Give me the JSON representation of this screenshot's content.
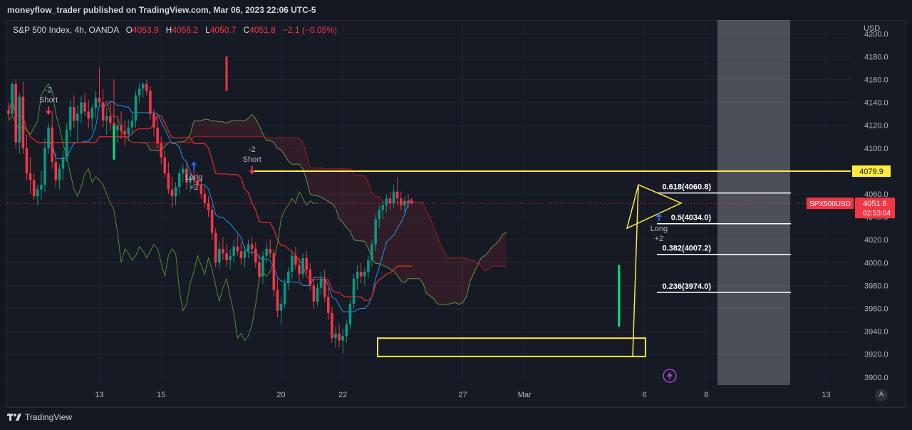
{
  "publisher": "moneyflow_trader published on TradingView.com, Mar 06, 2023 22:06 UTC-5",
  "legend": {
    "symbol": "S&P 500 Index, 4h, OANDA",
    "o_label": "O",
    "o_value": "4053.9",
    "h_label": "H",
    "h_value": "4056.2",
    "l_label": "L",
    "l_value": "4050.7",
    "c_label": "C",
    "c_value": "4051.8",
    "change": "−2.1 (−0.05%)"
  },
  "currency": "USD",
  "brand": "TradingView",
  "colors": {
    "up": "#089981",
    "down": "#f23645",
    "highlight": "#ffeb3b",
    "baseline": "#2962ff",
    "leading": "#7cb342",
    "lagging": "#b71c1c",
    "conversion": "#2196f3"
  },
  "chart_data": {
    "type": "candlestick",
    "interval": "4h",
    "ylim": [
      3893,
      4212
    ],
    "y_ticks": [
      "3900.0",
      "3920.0",
      "3940.0",
      "3960.0",
      "3980.0",
      "4000.0",
      "4020.0",
      "4040.0",
      "4060.0",
      "4080.0",
      "4100.0",
      "4120.0",
      "4140.0",
      "4160.0",
      "4180.0",
      "4200.0"
    ],
    "x_ticks": [
      {
        "label": "13",
        "bar": 25
      },
      {
        "label": "15",
        "bar": 42
      },
      {
        "label": "20",
        "bar": 75
      },
      {
        "label": "22",
        "bar": 92
      },
      {
        "label": "27",
        "bar": 125
      },
      {
        "label": "Mar",
        "bar": 142
      },
      {
        "label": "6",
        "bar": 175
      },
      {
        "label": "8",
        "bar": 192
      },
      {
        "label": "13",
        "bar": 225
      }
    ],
    "last_price": {
      "value": 4051.8,
      "symbol": "SPX500USD",
      "countdown": "02:53:04"
    },
    "horizontal_level": {
      "value": 4079.9,
      "label": "4079.9"
    },
    "fib_levels": [
      {
        "label": "0.618(4060.8)",
        "value": 4060.8
      },
      {
        "label": "0.5(4034.0)",
        "value": 4034.0
      },
      {
        "label": "0.382(4007.2)",
        "value": 4007.2
      },
      {
        "label": "0.236(3974.0)",
        "value": 3974.0
      }
    ],
    "signals": [
      {
        "type": "Short",
        "strength": "-2",
        "bar": 11,
        "price": 4140
      },
      {
        "type": "Long",
        "strength": "+2",
        "bar": 51,
        "price": 4085
      },
      {
        "type": "Short",
        "strength": "-2",
        "bar": 67,
        "price": 4088
      },
      {
        "type": "Long",
        "strength": "+2",
        "bar": 179,
        "price": 4040
      }
    ],
    "candles": [
      [
        4133,
        4140,
        4125,
        4130
      ],
      [
        4130,
        4158,
        4128,
        4156
      ],
      [
        4156,
        4160,
        4100,
        4105
      ],
      [
        4105,
        4148,
        4095,
        4145
      ],
      [
        4145,
        4158,
        4095,
        4100
      ],
      [
        4100,
        4112,
        4072,
        4078
      ],
      [
        4078,
        4092,
        4060,
        4072
      ],
      [
        4072,
        4078,
        4055,
        4058
      ],
      [
        4058,
        4068,
        4050,
        4064
      ],
      [
        4064,
        4080,
        4055,
        4068
      ],
      [
        4068,
        4108,
        4062,
        4100
      ],
      [
        4100,
        4122,
        4095,
        4118
      ],
      [
        4118,
        4132,
        4082,
        4088
      ],
      [
        4088,
        4096,
        4066,
        4072
      ],
      [
        4072,
        4086,
        4064,
        4082
      ],
      [
        4082,
        4098,
        4072,
        4092
      ],
      [
        4092,
        4122,
        4088,
        4116
      ],
      [
        4116,
        4142,
        4110,
        4136
      ],
      [
        4136,
        4146,
        4118,
        4124
      ],
      [
        4124,
        4138,
        4105,
        4130
      ],
      [
        4130,
        4146,
        4122,
        4140
      ],
      [
        4140,
        4148,
        4128,
        4132
      ],
      [
        4132,
        4142,
        4118,
        4126
      ],
      [
        4126,
        4138,
        4116,
        4135
      ],
      [
        4135,
        4150,
        4126,
        4144
      ],
      [
        4144,
        4170,
        4138,
        4140
      ],
      [
        4140,
        4152,
        4118,
        4124
      ],
      [
        4124,
        4135,
        4112,
        4128
      ],
      [
        4128,
        4140,
        4115,
        4122
      ],
      [
        4122,
        4160,
        4110,
        4116
      ],
      [
        4116,
        4126,
        4105,
        4120
      ],
      [
        4120,
        4132,
        4108,
        4115
      ],
      [
        4115,
        4124,
        4102,
        4112
      ],
      [
        4112,
        4125,
        4106,
        4118
      ],
      [
        4118,
        4130,
        4112,
        4124
      ],
      [
        4124,
        4150,
        4118,
        4146
      ],
      [
        4146,
        4157,
        4140,
        4152
      ],
      [
        4152,
        4158,
        4144,
        4156
      ],
      [
        4156,
        4160,
        4146,
        4150
      ],
      [
        4150,
        4154,
        4125,
        4130
      ],
      [
        4130,
        4134,
        4110,
        4118
      ],
      [
        4118,
        4128,
        4100,
        4104
      ],
      [
        4104,
        4110,
        4086,
        4092
      ],
      [
        4092,
        4098,
        4074,
        4078
      ],
      [
        4078,
        4088,
        4060,
        4064
      ],
      [
        4064,
        4075,
        4048,
        4058
      ],
      [
        4058,
        4070,
        4050,
        4066
      ],
      [
        4066,
        4082,
        4060,
        4078
      ],
      [
        4078,
        4086,
        4070,
        4082
      ],
      [
        4082,
        4088,
        4064,
        4070
      ],
      [
        4070,
        4080,
        4062,
        4075
      ],
      [
        4075,
        4084,
        4066,
        4072
      ],
      [
        4072,
        4078,
        4064,
        4068
      ],
      [
        4068,
        4074,
        4056,
        4060
      ],
      [
        4060,
        4066,
        4048,
        4052
      ],
      [
        4052,
        4058,
        4040,
        4046
      ],
      [
        4046,
        4050,
        4020,
        4026
      ],
      [
        4026,
        4030,
        3996,
        4000
      ],
      [
        4000,
        4018,
        3995,
        4012
      ],
      [
        4012,
        4022,
        4002,
        4008
      ],
      [
        4008,
        4016,
        3996,
        4002
      ],
      [
        4002,
        4012,
        3994,
        4006
      ],
      [
        4006,
        4020,
        4000,
        4014
      ],
      [
        4014,
        4024,
        4006,
        4010
      ],
      [
        4010,
        4018,
        3998,
        4004
      ],
      [
        4004,
        4014,
        3996,
        4010
      ],
      [
        4010,
        4020,
        4004,
        4016
      ],
      [
        4016,
        4022,
        4006,
        4012
      ],
      [
        4012,
        4018,
        3996,
        4000
      ],
      [
        4000,
        4008,
        3984,
        3988
      ],
      [
        3988,
        4010,
        3982,
        4006
      ],
      [
        4006,
        4018,
        4000,
        4012
      ],
      [
        4012,
        4020,
        4004,
        4008
      ],
      [
        4008,
        4012,
        3970,
        3976
      ],
      [
        3976,
        3986,
        3952,
        3958
      ],
      [
        3958,
        3970,
        3946,
        3964
      ],
      [
        3964,
        3986,
        3960,
        3982
      ],
      [
        3982,
        3996,
        3976,
        3992
      ],
      [
        3992,
        4010,
        3986,
        4006
      ],
      [
        4006,
        4014,
        3994,
        3998
      ],
      [
        3998,
        4004,
        3984,
        3990
      ],
      [
        3990,
        4008,
        3986,
        4004
      ],
      [
        4004,
        4010,
        3990,
        3994
      ],
      [
        3994,
        4000,
        3976,
        3980
      ],
      [
        3980,
        3986,
        3960,
        3966
      ],
      [
        3966,
        3982,
        3962,
        3978
      ],
      [
        3978,
        3992,
        3972,
        3986
      ],
      [
        3986,
        3994,
        3966,
        3970
      ],
      [
        3970,
        3978,
        3950,
        3956
      ],
      [
        3956,
        3962,
        3930,
        3934
      ],
      [
        3934,
        3944,
        3926,
        3938
      ],
      [
        3938,
        3946,
        3926,
        3932
      ],
      [
        3932,
        3942,
        3920,
        3936
      ],
      [
        3936,
        3950,
        3930,
        3946
      ],
      [
        3946,
        3968,
        3942,
        3964
      ],
      [
        3964,
        3990,
        3960,
        3986
      ],
      [
        3986,
        3998,
        3976,
        3992
      ],
      [
        3992,
        4000,
        3982,
        3988
      ],
      [
        3988,
        3996,
        3980,
        3992
      ],
      [
        3992,
        4006,
        3986,
        4002
      ],
      [
        4002,
        4020,
        3996,
        4016
      ],
      [
        4016,
        4042,
        4010,
        4038
      ],
      [
        4038,
        4050,
        4030,
        4046
      ],
      [
        4046,
        4054,
        4038,
        4050
      ],
      [
        4050,
        4060,
        4044,
        4056
      ],
      [
        4056,
        4062,
        4046,
        4052
      ],
      [
        4052,
        4068,
        4048,
        4062
      ],
      [
        4062,
        4074,
        4050,
        4056
      ],
      [
        4056,
        4062,
        4046,
        4050
      ],
      [
        4050,
        4058,
        4044,
        4054
      ],
      [
        4054,
        4060,
        4048,
        4052
      ],
      [
        4053.9,
        4056.2,
        4050.7,
        4051.8
      ]
    ]
  }
}
